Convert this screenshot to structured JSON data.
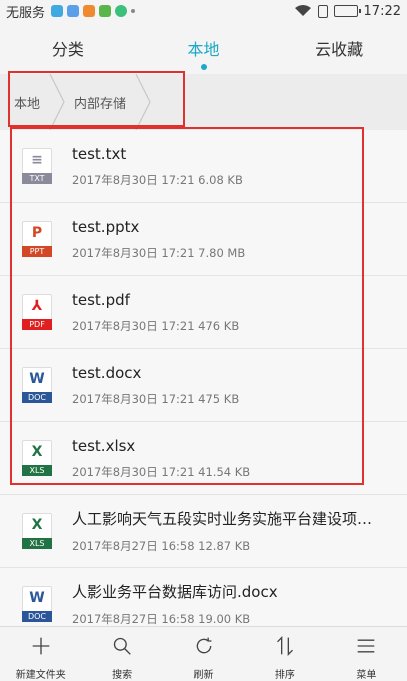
{
  "status_bar": {
    "carrier": "无服务",
    "time": "17:22",
    "battery_level": 0.85,
    "notification_icons": [
      "social-app-icon",
      "shield-app-icon",
      "bag-app-icon",
      "android-app-icon",
      "browser-app-icon",
      "more-dot-icon"
    ]
  },
  "tabs": [
    {
      "label": "分类",
      "active": false
    },
    {
      "label": "本地",
      "active": true
    },
    {
      "label": "云收藏",
      "active": false
    }
  ],
  "breadcrumb": [
    {
      "label": "本地"
    },
    {
      "label": "内部存储"
    }
  ],
  "files": [
    {
      "name": "test.txt",
      "meta": "2017年8月30日 17:21 6.08 KB",
      "type": "TXT",
      "glyph": "≡",
      "color": "#8a8a9a"
    },
    {
      "name": "test.pptx",
      "meta": "2017年8月30日 17:21 7.80 MB",
      "type": "PPT",
      "glyph": "P",
      "color": "#d24726"
    },
    {
      "name": "test.pdf",
      "meta": "2017年8月30日 17:21 476 KB",
      "type": "PDF",
      "glyph": "⅄",
      "color": "#e02020"
    },
    {
      "name": "test.docx",
      "meta": "2017年8月30日 17:21 475 KB",
      "type": "DOC",
      "glyph": "W",
      "color": "#2b579a"
    },
    {
      "name": "test.xlsx",
      "meta": "2017年8月30日 17:21 41.54 KB",
      "type": "XLS",
      "glyph": "X",
      "color": "#217346"
    },
    {
      "name": "人工影响天气五段实时业务实施平台建设项目实施方案.xlsx",
      "meta": "2017年8月27日 16:58 12.87 KB",
      "type": "XLS",
      "glyph": "X",
      "color": "#217346"
    },
    {
      "name": "人影业务平台数据库访问.docx",
      "meta": "2017年8月27日 16:58 19.00 KB",
      "type": "DOC",
      "glyph": "W",
      "color": "#2b579a"
    }
  ],
  "toolbar": [
    {
      "label": "新建文件夹",
      "icon": "plus-icon"
    },
    {
      "label": "搜索",
      "icon": "search-icon"
    },
    {
      "label": "刷新",
      "icon": "refresh-icon"
    },
    {
      "label": "排序",
      "icon": "sort-icon"
    },
    {
      "label": "菜单",
      "icon": "menu-icon"
    }
  ],
  "colors": {
    "accent": "#1aa9c7",
    "highlight": "#e0312c"
  }
}
